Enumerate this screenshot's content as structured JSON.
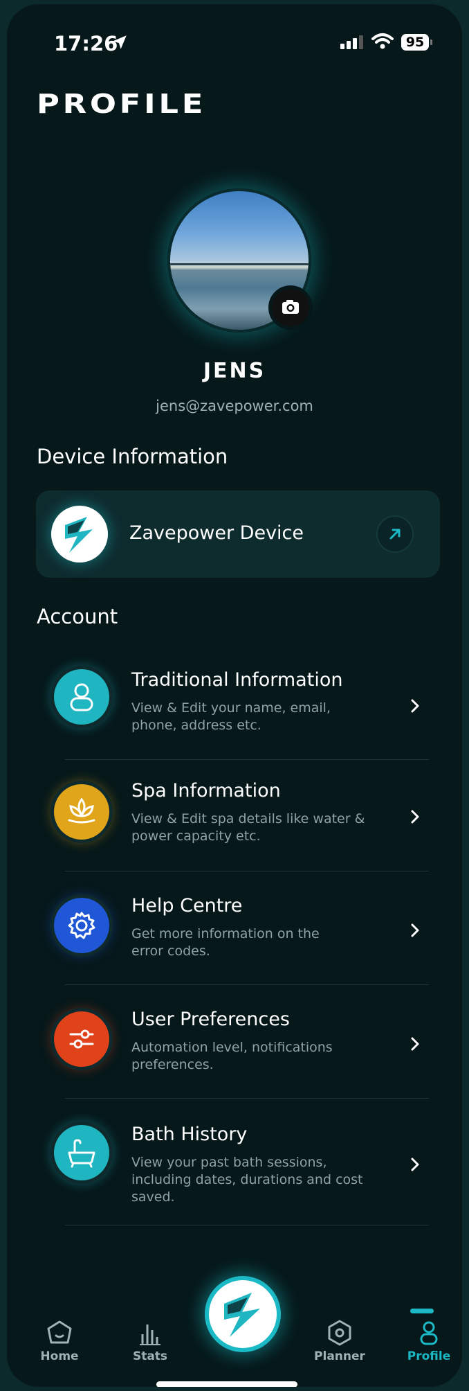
{
  "status_bar": {
    "time": "17:26",
    "battery": "95"
  },
  "header": {
    "title": "PROFILE"
  },
  "profile": {
    "name": "JENS",
    "email": "jens@zavepower.com"
  },
  "device_section": {
    "heading": "Device Information",
    "device_name": "Zavepower Device"
  },
  "account": {
    "heading": "Account",
    "items": [
      {
        "title": "Traditional Information",
        "subtitle_1": "View & Edit your name, email,",
        "subtitle_2": "phone, address etc.",
        "subtitle_3": "",
        "color": "#1fb5c1",
        "icon": "user-icon"
      },
      {
        "title": "Spa Information",
        "subtitle_1": "View & Edit spa details like water &",
        "subtitle_2": "power capacity etc.",
        "subtitle_3": "",
        "color": "#e0a51b",
        "icon": "lotus-icon"
      },
      {
        "title": "Help Centre",
        "subtitle_1": "Get more information on the",
        "subtitle_2": "error codes.",
        "subtitle_3": "",
        "color": "#1f57d6",
        "icon": "gear-icon"
      },
      {
        "title": "User Preferences",
        "subtitle_1": "Automation level, notifications",
        "subtitle_2": "preferences.",
        "subtitle_3": "",
        "color": "#e0421a",
        "icon": "sliders-icon"
      },
      {
        "title": "Bath History",
        "subtitle_1": "View your past bath sessions,",
        "subtitle_2": "including dates, durations and cost",
        "subtitle_3": "saved.",
        "color": "#1fb5c1",
        "icon": "bathtub-icon"
      }
    ]
  },
  "nav": {
    "home": "Home",
    "stats": "Stats",
    "planner": "Planner",
    "profile": "Profile",
    "active": "Profile",
    "active_color": "#1bb9c5"
  }
}
